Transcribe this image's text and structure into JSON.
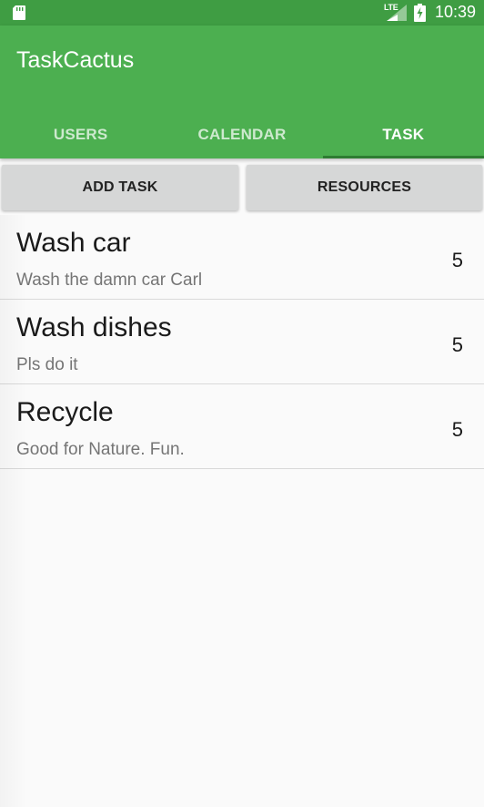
{
  "status_bar": {
    "time": "10:39",
    "network": "LTE",
    "icons": [
      "sd-card-icon",
      "signal-icon",
      "battery-charging-icon"
    ]
  },
  "app": {
    "title": "TaskCactus",
    "colors": {
      "primary": "#4caf50",
      "primary_dark": "#3f9d43",
      "tab_indicator": "#2e7d32",
      "button_bg": "#d6d7d7"
    }
  },
  "tabs": [
    {
      "label": "USERS",
      "active": false
    },
    {
      "label": "CALENDAR",
      "active": false
    },
    {
      "label": "TASK",
      "active": true
    }
  ],
  "actions": {
    "add_task": "ADD TASK",
    "resources": "RESOURCES"
  },
  "tasks": [
    {
      "title": "Wash car",
      "description": "Wash the damn car Carl",
      "count": "5"
    },
    {
      "title": "Wash dishes",
      "description": "Pls do it",
      "count": "5"
    },
    {
      "title": "Recycle",
      "description": "Good for Nature. Fun.",
      "count": "5"
    }
  ]
}
